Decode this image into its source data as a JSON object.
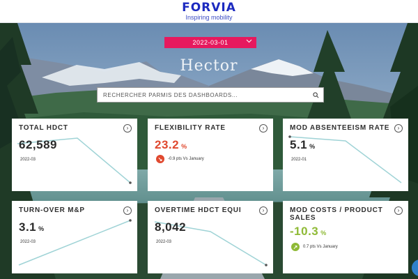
{
  "header": {
    "brand": "FORVIA",
    "tagline": "Inspiring mobility"
  },
  "filter": {
    "date": "2022-03-01",
    "chevron_icon": "chevron-down-icon"
  },
  "hero": {
    "title": "Hector"
  },
  "search": {
    "placeholder": "RECHERCHER PARMIS DES DASHBOARDS...",
    "icon": "search-icon"
  },
  "colors": {
    "brand": "#1c2ac0",
    "accent": "#e6195e",
    "negative": "#e0492f",
    "positive": "#8fba36",
    "sparkline": "#9fd3d6"
  },
  "cards": [
    {
      "title": "TOTAL HDCT",
      "value": "62,589",
      "unit": "",
      "period": "2022-03"
    },
    {
      "title": "FLEXIBILITY RATE",
      "value": "23.2",
      "unit": "%",
      "delta": "-0.9 pts Vs January",
      "trend": "down"
    },
    {
      "title": "MOD ABSENTEEISM RATE",
      "value": "5.1",
      "unit": "%",
      "period": "2022-01"
    },
    {
      "title": "TURN-OVER M&P",
      "value": "3.1",
      "unit": "%",
      "period": "2022-03"
    },
    {
      "title": "OVERTIME HDCT EQUI",
      "value": "8,042",
      "unit": "",
      "period": "2022-03"
    },
    {
      "title": "MOD COSTS / PRODUCT SALES",
      "value": "-10.3",
      "unit": "%",
      "delta": "0.7 pts Vs January",
      "trend": "up"
    }
  ]
}
